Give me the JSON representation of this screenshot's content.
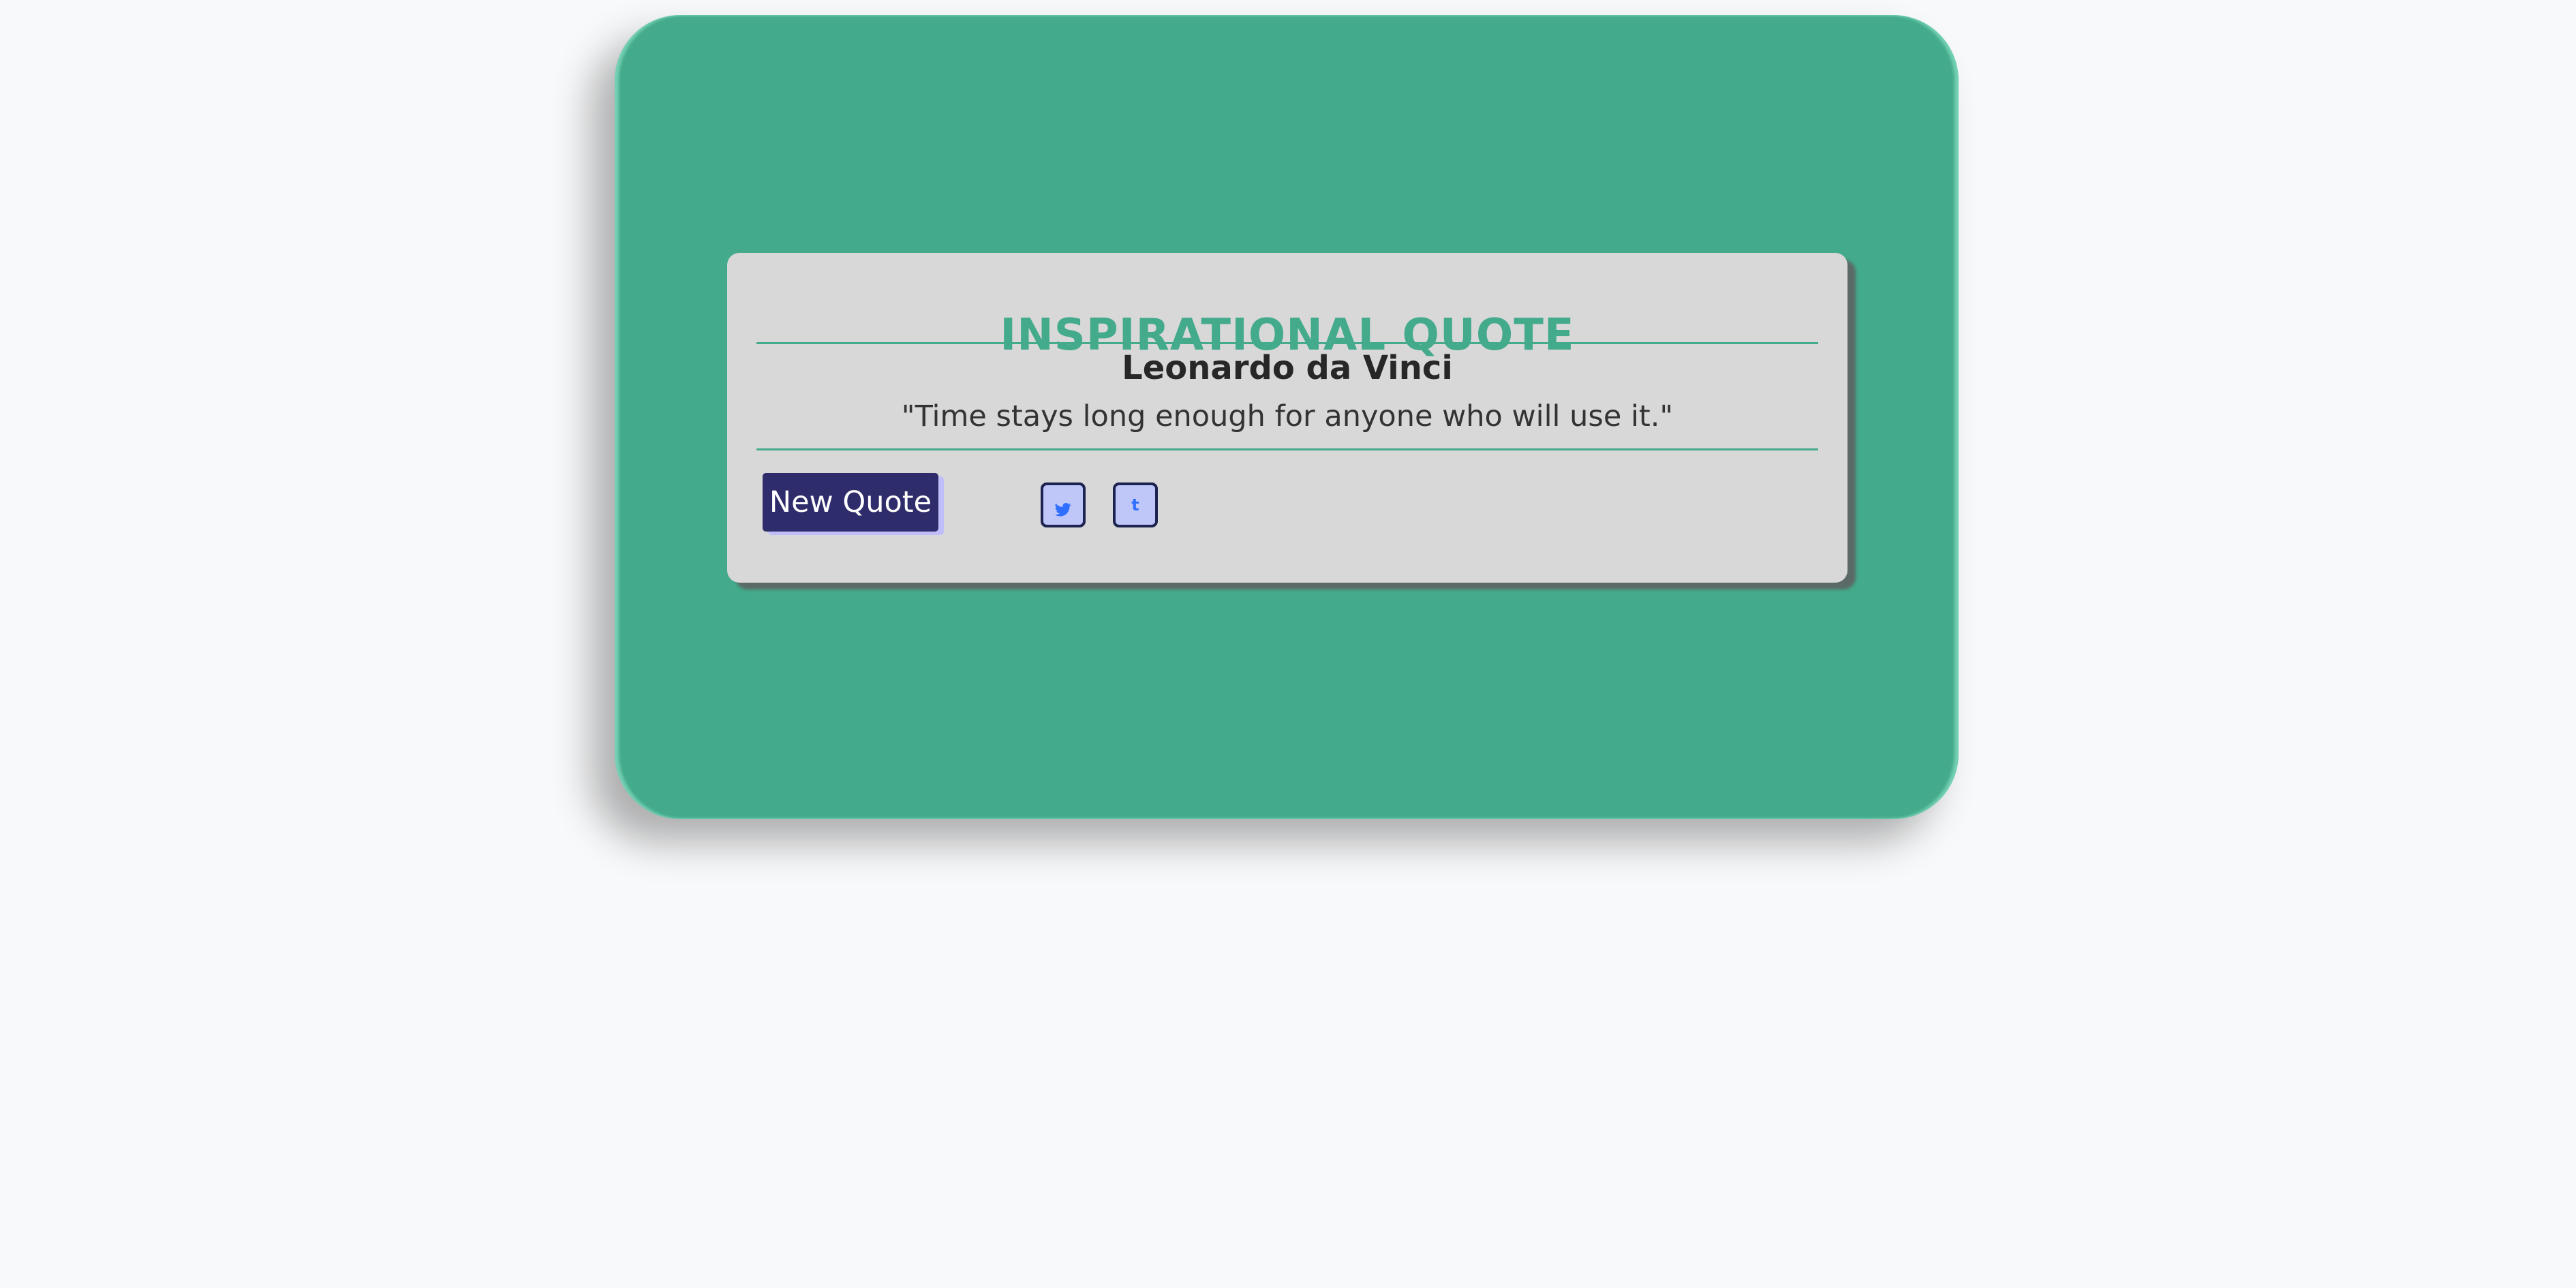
{
  "app": {
    "title": "INSPIRATIONAL QUOTE"
  },
  "quote": {
    "author": "Leonardo da Vinci",
    "text": "\"Time stays long enough for anyone who will use it.\""
  },
  "actions": {
    "new_quote_label": "New Quote",
    "share_icons": [
      {
        "name": "twitter-icon",
        "glyph": ""
      },
      {
        "name": "tumblr-icon",
        "glyph": "t"
      }
    ]
  },
  "colors": {
    "page_background": "#f8f9fa",
    "card_background": "#43aa8b",
    "quote_background": "#d8d8d8",
    "title_color": "#43aa8b",
    "button_background": "#2f2c6b",
    "icon_accent": "#2f6fff"
  }
}
